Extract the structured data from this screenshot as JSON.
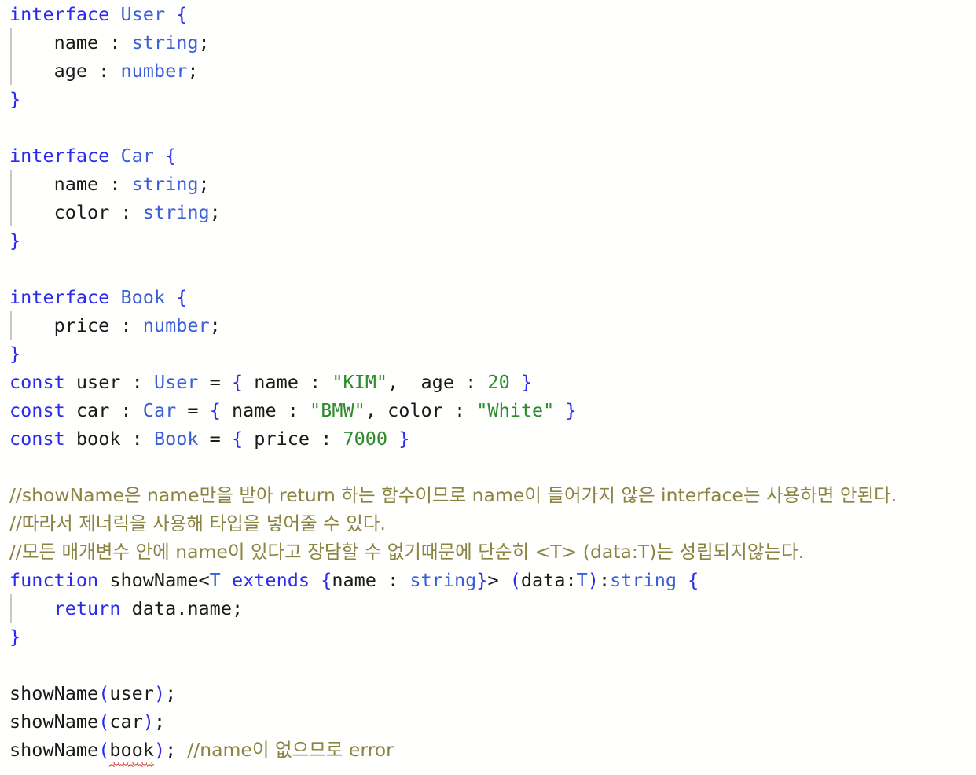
{
  "editor": {
    "language": "typescript",
    "background_color": "#fffffd",
    "colors": {
      "keyword": "#2a2af0",
      "type": "#3a5fd9",
      "plain": "#1a1a1a",
      "string": "#2e8b2e",
      "number": "#2e8b2e",
      "comment": "#8a8342",
      "indent_guide": "#c8c8c8",
      "error_squiggle": "#d62b1f"
    },
    "lines": [
      {
        "n": 1,
        "tokens": [
          {
            "t": "interface",
            "c": "kw"
          },
          {
            "t": " ",
            "c": "pln"
          },
          {
            "t": "User",
            "c": "typ"
          },
          {
            "t": " ",
            "c": "pln"
          },
          {
            "t": "{",
            "c": "brc"
          }
        ]
      },
      {
        "n": 2,
        "guide": true,
        "tokens": [
          {
            "t": "    name : ",
            "c": "pln"
          },
          {
            "t": "string",
            "c": "typ"
          },
          {
            "t": ";",
            "c": "pun"
          }
        ]
      },
      {
        "n": 3,
        "guide": true,
        "tokens": [
          {
            "t": "    age : ",
            "c": "pln"
          },
          {
            "t": "number",
            "c": "typ"
          },
          {
            "t": ";",
            "c": "pun"
          }
        ]
      },
      {
        "n": 4,
        "tokens": [
          {
            "t": "}",
            "c": "brc"
          }
        ]
      },
      {
        "n": 5,
        "tokens": []
      },
      {
        "n": 6,
        "tokens": [
          {
            "t": "interface",
            "c": "kw"
          },
          {
            "t": " ",
            "c": "pln"
          },
          {
            "t": "Car",
            "c": "typ"
          },
          {
            "t": " ",
            "c": "pln"
          },
          {
            "t": "{",
            "c": "brc"
          }
        ]
      },
      {
        "n": 7,
        "guide": true,
        "tokens": [
          {
            "t": "    name : ",
            "c": "pln"
          },
          {
            "t": "string",
            "c": "typ"
          },
          {
            "t": ";",
            "c": "pun"
          }
        ]
      },
      {
        "n": 8,
        "guide": true,
        "tokens": [
          {
            "t": "    color : ",
            "c": "pln"
          },
          {
            "t": "string",
            "c": "typ"
          },
          {
            "t": ";",
            "c": "pun"
          }
        ]
      },
      {
        "n": 9,
        "tokens": [
          {
            "t": "}",
            "c": "brc"
          }
        ]
      },
      {
        "n": 10,
        "tokens": []
      },
      {
        "n": 11,
        "tokens": [
          {
            "t": "interface",
            "c": "kw"
          },
          {
            "t": " ",
            "c": "pln"
          },
          {
            "t": "Book",
            "c": "typ"
          },
          {
            "t": " ",
            "c": "pln"
          },
          {
            "t": "{",
            "c": "brc"
          }
        ]
      },
      {
        "n": 12,
        "guide": true,
        "tokens": [
          {
            "t": "    price : ",
            "c": "pln"
          },
          {
            "t": "number",
            "c": "typ"
          },
          {
            "t": ";",
            "c": "pun"
          }
        ]
      },
      {
        "n": 13,
        "tokens": [
          {
            "t": "}",
            "c": "brc"
          }
        ]
      },
      {
        "n": 14,
        "tokens": [
          {
            "t": "const",
            "c": "kw"
          },
          {
            "t": " user : ",
            "c": "pln"
          },
          {
            "t": "User",
            "c": "typ"
          },
          {
            "t": " = ",
            "c": "pln"
          },
          {
            "t": "{",
            "c": "brc"
          },
          {
            "t": " name : ",
            "c": "pln"
          },
          {
            "t": "\"KIM\"",
            "c": "str"
          },
          {
            "t": ",  age : ",
            "c": "pln"
          },
          {
            "t": "20",
            "c": "num"
          },
          {
            "t": " ",
            "c": "pln"
          },
          {
            "t": "}",
            "c": "brc"
          }
        ]
      },
      {
        "n": 15,
        "tokens": [
          {
            "t": "const",
            "c": "kw"
          },
          {
            "t": " car : ",
            "c": "pln"
          },
          {
            "t": "Car",
            "c": "typ"
          },
          {
            "t": " = ",
            "c": "pln"
          },
          {
            "t": "{",
            "c": "brc"
          },
          {
            "t": " name : ",
            "c": "pln"
          },
          {
            "t": "\"BMW\"",
            "c": "str"
          },
          {
            "t": ", color : ",
            "c": "pln"
          },
          {
            "t": "\"White\"",
            "c": "str"
          },
          {
            "t": " ",
            "c": "pln"
          },
          {
            "t": "}",
            "c": "brc"
          }
        ]
      },
      {
        "n": 16,
        "tokens": [
          {
            "t": "const",
            "c": "kw"
          },
          {
            "t": " book : ",
            "c": "pln"
          },
          {
            "t": "Book",
            "c": "typ"
          },
          {
            "t": " = ",
            "c": "pln"
          },
          {
            "t": "{",
            "c": "brc"
          },
          {
            "t": " price : ",
            "c": "pln"
          },
          {
            "t": "7000",
            "c": "num"
          },
          {
            "t": " ",
            "c": "pln"
          },
          {
            "t": "}",
            "c": "brc"
          }
        ]
      },
      {
        "n": 17,
        "tokens": []
      },
      {
        "n": 18,
        "tokens": [
          {
            "t": "//showName은 name만을 받아 return 하는 함수이므로 name이 들어가지 않은 interface는 사용하면 안된다.",
            "c": "cmt"
          }
        ]
      },
      {
        "n": 19,
        "tokens": [
          {
            "t": "//따라서 제너릭을 사용해 타입을 넣어줄 수 있다.",
            "c": "cmt"
          }
        ]
      },
      {
        "n": 20,
        "tokens": [
          {
            "t": "//모든 매개변수 안에 name이 있다고 장담할 수 없기때문에 단순히 <T> (data:T)는 성립되지않는다.",
            "c": "cmt"
          }
        ]
      },
      {
        "n": 21,
        "tokens": [
          {
            "t": "function",
            "c": "kw"
          },
          {
            "t": " showName<",
            "c": "pln"
          },
          {
            "t": "T",
            "c": "typ"
          },
          {
            "t": " ",
            "c": "pln"
          },
          {
            "t": "extends",
            "c": "kw"
          },
          {
            "t": " ",
            "c": "pln"
          },
          {
            "t": "{",
            "c": "brc"
          },
          {
            "t": "name : ",
            "c": "pln"
          },
          {
            "t": "string",
            "c": "typ"
          },
          {
            "t": "}",
            "c": "brc"
          },
          {
            "t": "> ",
            "c": "pln"
          },
          {
            "t": "(",
            "c": "brc"
          },
          {
            "t": "data:",
            "c": "pln"
          },
          {
            "t": "T",
            "c": "typ"
          },
          {
            "t": ")",
            "c": "brc"
          },
          {
            "t": ":",
            "c": "pun"
          },
          {
            "t": "string",
            "c": "typ"
          },
          {
            "t": " ",
            "c": "pln"
          },
          {
            "t": "{",
            "c": "brc"
          }
        ]
      },
      {
        "n": 22,
        "guide": true,
        "tokens": [
          {
            "t": "    ",
            "c": "pln"
          },
          {
            "t": "return",
            "c": "kw"
          },
          {
            "t": " data.name;",
            "c": "pln"
          }
        ]
      },
      {
        "n": 23,
        "tokens": [
          {
            "t": "}",
            "c": "brc"
          }
        ]
      },
      {
        "n": 24,
        "tokens": []
      },
      {
        "n": 25,
        "tokens": [
          {
            "t": "showName",
            "c": "pln"
          },
          {
            "t": "(",
            "c": "brc"
          },
          {
            "t": "user",
            "c": "pln"
          },
          {
            "t": ")",
            "c": "brc"
          },
          {
            "t": ";",
            "c": "pun"
          }
        ]
      },
      {
        "n": 26,
        "tokens": [
          {
            "t": "showName",
            "c": "pln"
          },
          {
            "t": "(",
            "c": "brc"
          },
          {
            "t": "car",
            "c": "pln"
          },
          {
            "t": ")",
            "c": "brc"
          },
          {
            "t": ";",
            "c": "pun"
          }
        ]
      },
      {
        "n": 27,
        "tokens": [
          {
            "t": "showName",
            "c": "pln"
          },
          {
            "t": "(",
            "c": "brc"
          },
          {
            "t": "book",
            "c": "pln",
            "error": true
          },
          {
            "t": ")",
            "c": "brc"
          },
          {
            "t": "; ",
            "c": "pun"
          },
          {
            "t": "//name이 없으므로 error",
            "c": "cmt"
          }
        ]
      }
    ]
  }
}
